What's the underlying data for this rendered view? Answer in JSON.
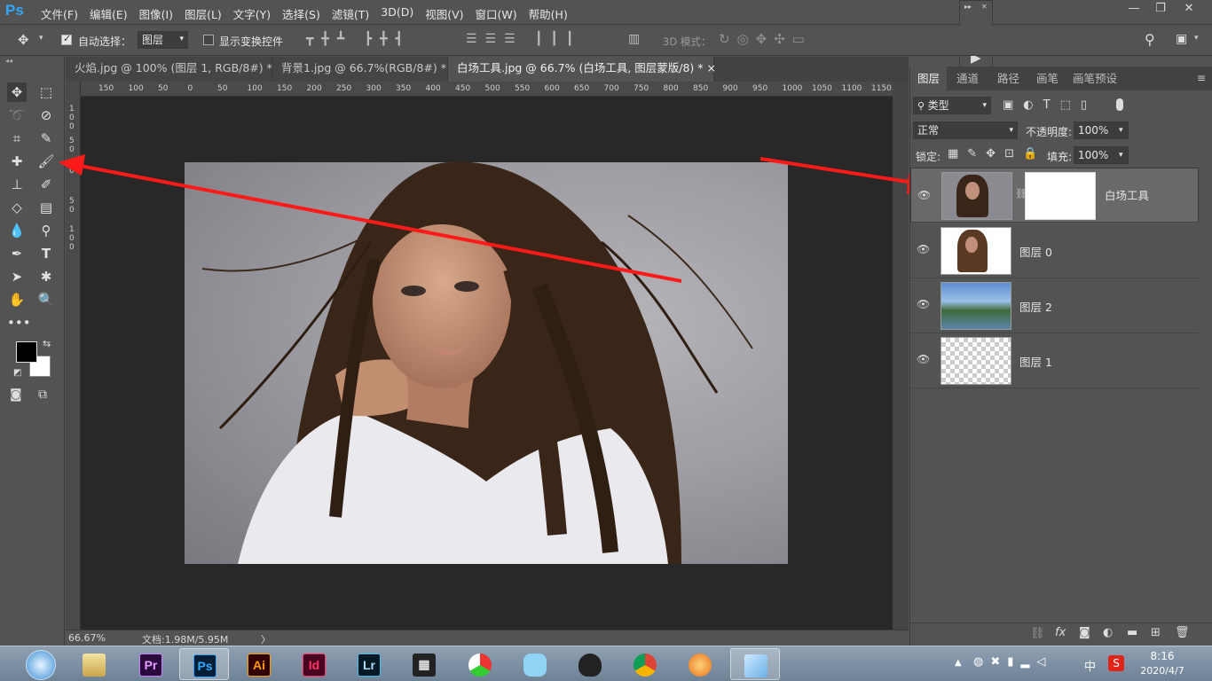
{
  "app": {
    "logo": "Ps"
  },
  "menu": [
    "文件(F)",
    "编辑(E)",
    "图像(I)",
    "图层(L)",
    "文字(Y)",
    "选择(S)",
    "滤镜(T)",
    "3D(D)",
    "视图(V)",
    "窗口(W)",
    "帮助(H)"
  ],
  "options": {
    "auto_select_label": "自动选择：",
    "auto_select_value": "图层",
    "show_transform_label": "显示变换控件",
    "mode_3d_label": "3D 模式："
  },
  "tabs": [
    {
      "label": "火焰.jpg @ 100% (图层 1, RGB/8#) *",
      "close": "×"
    },
    {
      "label": "背景1.jpg @ 66.7%(RGB/8#) *",
      "close": "×"
    },
    {
      "label": "白场工具.jpg @ 66.7% (白场工具, 图层蒙版/8) *",
      "close": "×"
    }
  ],
  "ruler_h": [
    "150",
    "100",
    "50",
    "0",
    "50",
    "100",
    "150",
    "200",
    "250",
    "300",
    "350",
    "400",
    "450",
    "500",
    "550",
    "600",
    "650",
    "700",
    "750",
    "800",
    "850",
    "900",
    "950",
    "1000",
    "1050",
    "1100",
    "1150"
  ],
  "status": {
    "zoom": "66.67%",
    "doc": "文档:1.98M/5.95M",
    "arrow": "〉"
  },
  "panel": {
    "tabs": [
      "图层",
      "通道",
      "路径",
      "画笔",
      "画笔预设"
    ],
    "filter_label": "类型",
    "blend_mode": "正常",
    "opacity_label": "不透明度:",
    "opacity_value": "100%",
    "lock_label": "锁定:",
    "fill_label": "填充:",
    "fill_value": "100%",
    "layers": [
      {
        "name": "白场工具",
        "selected": true
      },
      {
        "name": "图层 0",
        "selected": false
      },
      {
        "name": "图层 2",
        "selected": false
      },
      {
        "name": "图层 1",
        "selected": false
      }
    ]
  },
  "taskbar": {
    "apps": [
      "Pr",
      "Ps",
      "Ai",
      "Id",
      "Lr"
    ],
    "tray_ime": "中",
    "time": "8:16",
    "date": "2020/4/7"
  },
  "colors": {
    "accent": "#31a8ff",
    "arrow": "#ff1a1a"
  }
}
